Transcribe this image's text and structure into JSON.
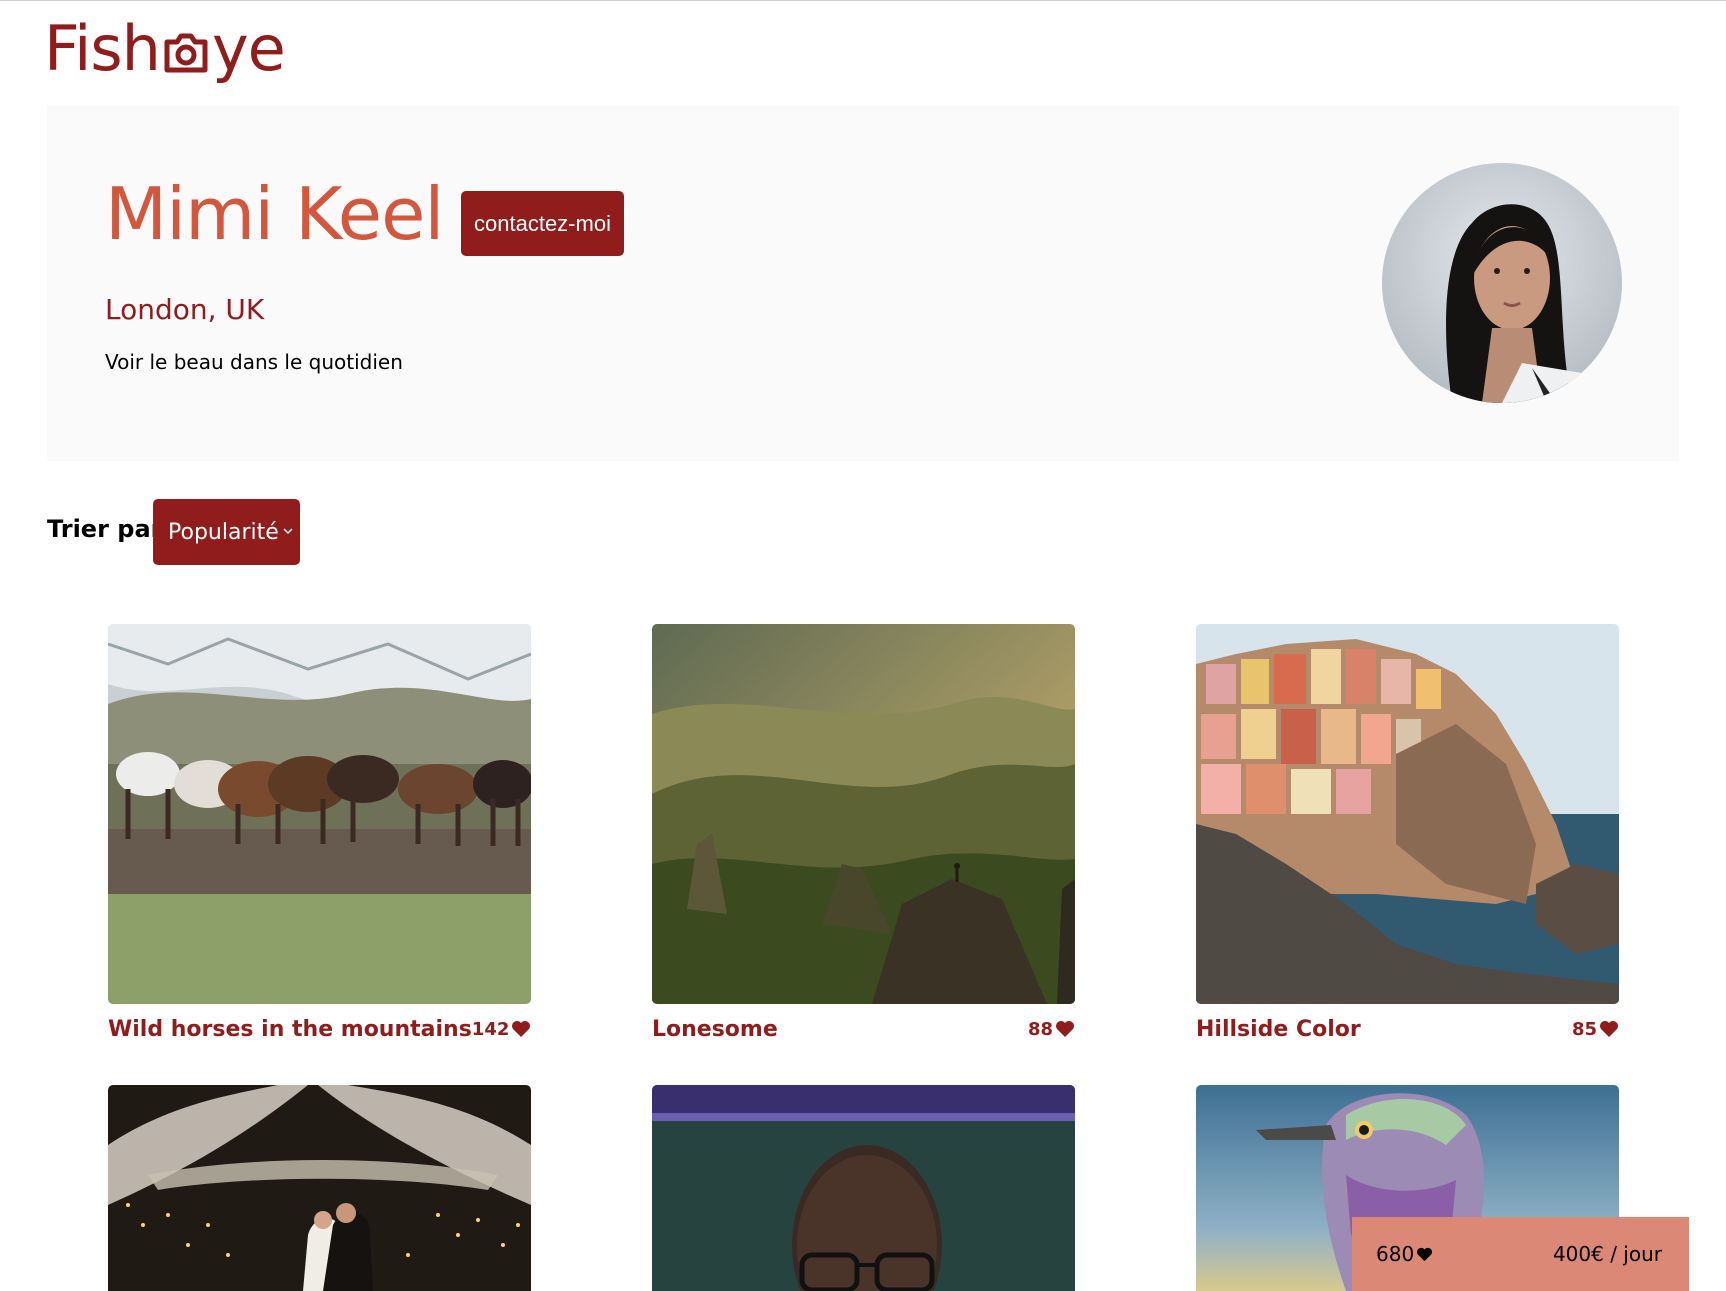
{
  "logo": {
    "text_before": "Fish",
    "text_after": "ye",
    "icon": "camera-icon"
  },
  "photographer": {
    "name": "Mimi Keel",
    "location": "London, UK",
    "tagline": "Voir le beau dans le quotidien",
    "contact_label": "contactez-moi",
    "portrait": "portrait-photo"
  },
  "sort": {
    "label": "Trier par",
    "selected": "Popularité"
  },
  "media": [
    {
      "title": "Wild horses in the mountains",
      "likes": "142",
      "image": "horses-photo"
    },
    {
      "title": "Lonesome",
      "likes": "88",
      "image": "mountain-photo"
    },
    {
      "title": "Hillside Color",
      "likes": "85",
      "image": "cliff-village-photo"
    },
    {
      "title": "",
      "likes": "",
      "image": "wedding-photo"
    },
    {
      "title": "",
      "likes": "",
      "image": "portrait-glasses-photo"
    },
    {
      "title": "",
      "likes": "",
      "image": "bird-photo"
    }
  ],
  "stats": {
    "total_likes": "680",
    "price": "400€ / jour"
  },
  "colors": {
    "primary": "#901c1c",
    "secondary": "#d3573c",
    "accent_bg": "#db8876",
    "header_bg": "#fafafa"
  }
}
